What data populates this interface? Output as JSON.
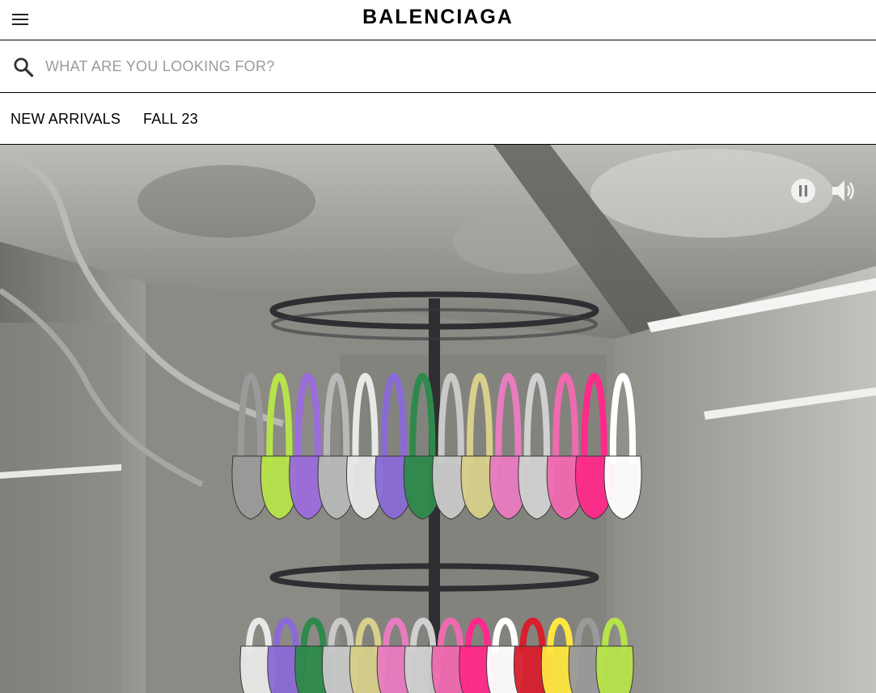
{
  "header": {
    "menu_icon": "hamburger-menu-icon",
    "logo": "BALENCIAGA"
  },
  "search": {
    "icon": "search-icon",
    "placeholder": "WHAT ARE YOU LOOKING FOR?",
    "value": ""
  },
  "nav": {
    "items": [
      {
        "label": "NEW ARRIVALS"
      },
      {
        "label": "FALL 23"
      }
    ]
  },
  "hero": {
    "media": "video",
    "controls": {
      "pause_icon": "pause-icon",
      "sound_icon": "speaker-volume-icon"
    },
    "bag_colors": [
      "#9a9a9a",
      "#b7e34a",
      "#9b6cdc",
      "#b8b8b8",
      "#e8e8e8",
      "#8a6bd6",
      "#2e8a4c",
      "#c9c9c9",
      "#d8cf8a",
      "#e97bc0",
      "#d0d0d0",
      "#f06ab0",
      "#ff2a8a",
      "#ffffff",
      "#d91e2c",
      "#ffe640"
    ]
  }
}
